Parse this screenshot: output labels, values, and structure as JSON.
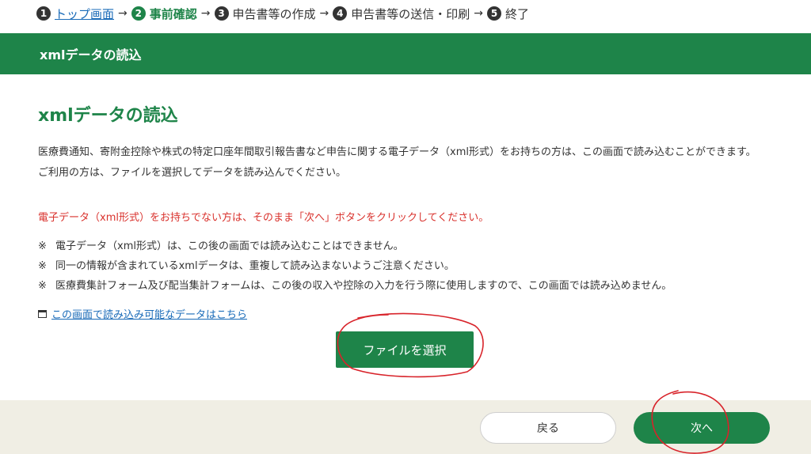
{
  "steps": [
    {
      "num": "1",
      "label": "トップ画面"
    },
    {
      "num": "2",
      "label": "事前確認"
    },
    {
      "num": "3",
      "label": "申告書等の作成"
    },
    {
      "num": "4",
      "label": "申告書等の送信・印刷"
    },
    {
      "num": "5",
      "label": "終了"
    }
  ],
  "step_arrow": "→",
  "banner": {
    "title": "xmlデータの読込"
  },
  "main": {
    "title": "xmlデータの読込",
    "description": [
      "医療費通知、寄附金控除や株式の特定口座年間取引報告書など申告に関する電子データ（xml形式）をお持ちの方は、この画面で読み込むことができます。",
      "ご利用の方は、ファイルを選択してデータを読み込んでください。"
    ],
    "warning": "電子データ（xml形式）をお持ちでない方は、そのまま「次へ」ボタンをクリックしてください。",
    "note_mark": "※",
    "notes": [
      "電子データ（xml形式）は、この後の画面では読み込むことはできません。",
      "同一の情報が含まれているxmlデータは、重複して読み込まないようご注意ください。",
      "医療費集計フォーム及び配当集計フォームは、この後の収入や控除の入力を行う際に使用しますので、この画面では読み込めません。"
    ],
    "readable_data_link": "この画面で読み込み可能なデータはこちら",
    "file_select_label": "ファイルを選択"
  },
  "footer": {
    "back_label": "戻る",
    "next_label": "次へ"
  },
  "colors": {
    "brand_green": "#1e8449",
    "warning_red": "#d9322d",
    "link_blue": "#1a6bb8",
    "annotation_red": "#d8232a"
  },
  "icons": {
    "readable_data_link": "window-icon"
  }
}
